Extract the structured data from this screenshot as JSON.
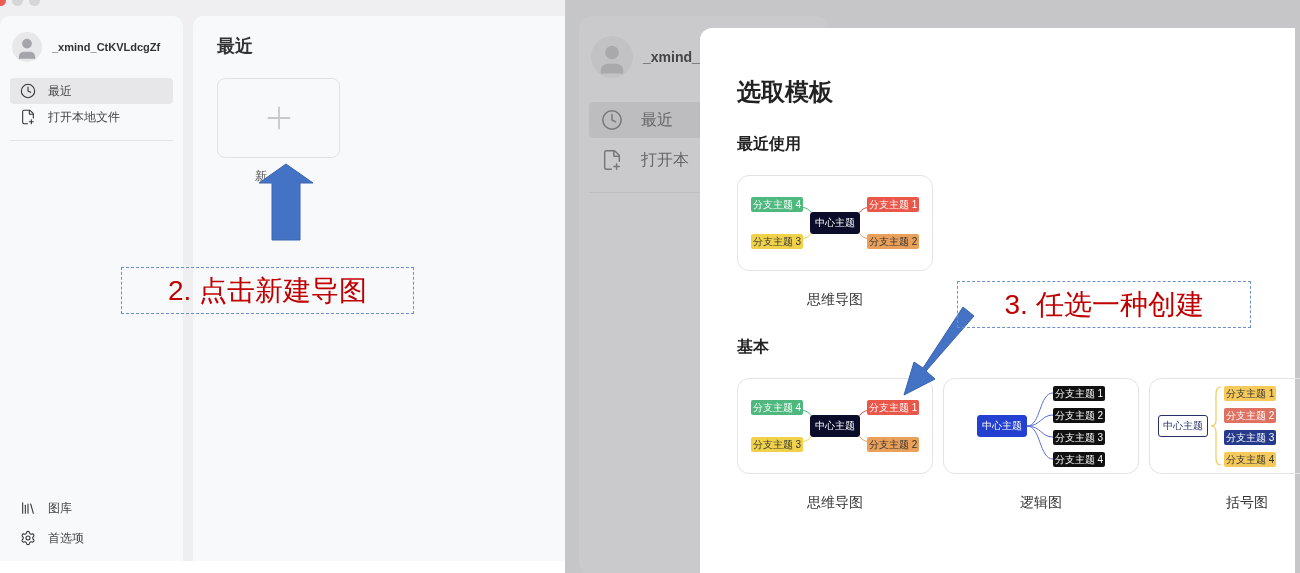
{
  "left_window": {
    "sidebar": {
      "user": "_xmind_CtKVLdcgZf",
      "items": [
        {
          "kind": "clock",
          "label": "最近",
          "selected": true
        },
        {
          "kind": "file-add",
          "label": "打开本地文件",
          "selected": false
        }
      ],
      "bottom_items": [
        {
          "kind": "library",
          "label": "图库"
        },
        {
          "kind": "gear",
          "label": "首选项"
        }
      ]
    },
    "main": {
      "title": "最近",
      "new_card_label": "新"
    }
  },
  "right_window": {
    "backdrop": {
      "user": "_xmind_",
      "items": [
        {
          "kind": "clock",
          "label": "最近",
          "selected": true
        },
        {
          "kind": "file-add",
          "label": "打开本",
          "selected": false
        }
      ]
    },
    "dialog": {
      "title": "选取模板",
      "sections": [
        {
          "heading": "最近使用",
          "templates": [
            {
              "kind": "mindmap",
              "name": "思维导图",
              "center": "中心主题",
              "branches": [
                {
                  "label": "分支主题 4",
                  "color": "#4fb87e"
                },
                {
                  "label": "分支主题 1",
                  "color": "#e8574a"
                },
                {
                  "label": "分支主题 3",
                  "color": "#f0d24a"
                },
                {
                  "label": "分支主题 2",
                  "color": "#e9a05b"
                }
              ]
            }
          ]
        },
        {
          "heading": "基本",
          "templates": [
            {
              "kind": "mindmap",
              "name": "思维导图",
              "center": "中心主题",
              "branches": [
                {
                  "label": "分支主题 4",
                  "color": "#4fb87e"
                },
                {
                  "label": "分支主题 1",
                  "color": "#e8574a"
                },
                {
                  "label": "分支主题 3",
                  "color": "#f0d24a"
                },
                {
                  "label": "分支主题 2",
                  "color": "#e9a05b"
                }
              ]
            },
            {
              "kind": "logic",
              "name": "逻辑图",
              "center": "中心主题",
              "branches": [
                {
                  "label": "分支主题 1",
                  "color": "#111111"
                },
                {
                  "label": "分支主题 2",
                  "color": "#111111"
                },
                {
                  "label": "分支主题 3",
                  "color": "#111111"
                },
                {
                  "label": "分支主题 4",
                  "color": "#111111"
                }
              ]
            },
            {
              "kind": "brace",
              "name": "括号图",
              "center": "中心主题",
              "branches": [
                {
                  "label": "分支主题 1",
                  "color": "#f5c95a"
                },
                {
                  "label": "分支主题 2",
                  "color": "#de7160"
                },
                {
                  "label": "分支主题 3",
                  "color": "#253a8a"
                },
                {
                  "label": "分支主题 4",
                  "color": "#f5c95a"
                }
              ]
            }
          ]
        }
      ]
    }
  },
  "annotations": [
    {
      "kind": "up-arrow",
      "text": "2. 点击新建导图"
    },
    {
      "kind": "diagonal-arrow",
      "text": "3. 任选一种创建"
    }
  ]
}
